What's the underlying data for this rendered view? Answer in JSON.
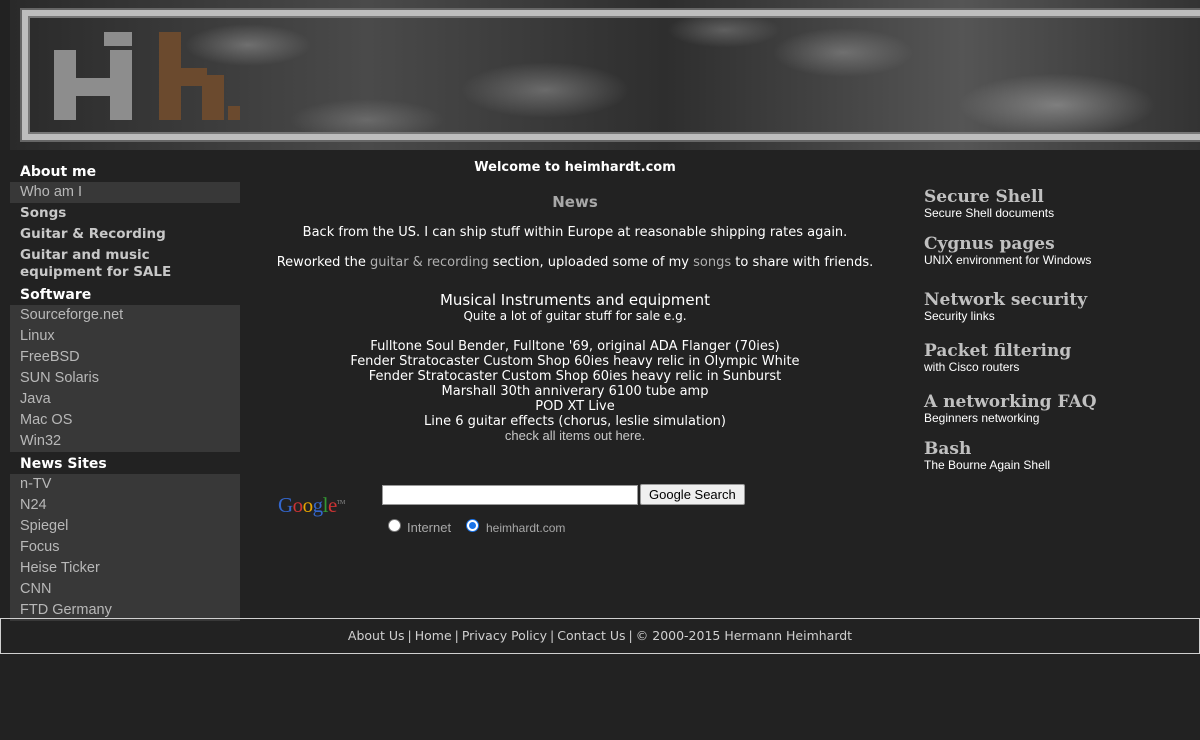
{
  "banner": {
    "logo_text": "hh."
  },
  "leftnav": {
    "about_head": "About me",
    "about_items": [
      "Who am I"
    ],
    "about_bold_items": [
      "Songs",
      "Guitar & Recording",
      "Guitar and music equipment for SALE"
    ],
    "software_head": "Software",
    "software_items": [
      "Sourceforge.net",
      "Linux",
      "FreeBSD",
      "SUN Solaris",
      "Java",
      "Mac OS",
      "Win32"
    ],
    "news_head": "News Sites",
    "news_items": [
      "n-TV",
      "N24",
      "Spiegel",
      "Focus",
      "Heise Ticker",
      "CNN",
      "FTD Germany"
    ]
  },
  "center": {
    "welcome": "Welcome to heimhardt.com",
    "news_title": "News",
    "news1": "Back from the US. I can ship stuff within Europe at reasonable shipping rates again.",
    "news2_pre": "Reworked the ",
    "news2_link1": "guitar & recording",
    "news2_mid": " section, uploaded some of my ",
    "news2_link2": "songs",
    "news2_post": " to share with friends.",
    "instr_title": "Musical Instruments and equipment",
    "instr_sub": "Quite a lot of guitar stuff for sale e.g.",
    "items": [
      "Fulltone Soul Bender, Fulltone '69, original ADA Flanger (70ies)",
      "Fender Stratocaster Custom Shop 60ies heavy relic in Olympic White",
      "Fender Stratocaster Custom Shop 60ies heavy relic in Sunburst",
      "Marshall 30th anniverary 6100 tube amp",
      "POD XT Live",
      "Line 6 guitar effects (chorus, leslie simulation)"
    ],
    "check_link": "check all items out here."
  },
  "search": {
    "logo_letters": [
      "G",
      "o",
      "o",
      "g",
      "l",
      "e"
    ],
    "logo_colors": [
      "#3366cc",
      "#cc3333",
      "#e6a300",
      "#3366cc",
      "#339933",
      "#cc3333"
    ],
    "logo_tm": "TM",
    "input_value": "",
    "button_label": "Google Search",
    "option_internet": "Internet",
    "option_site": "heimhardt.com",
    "selected": "heimhardt.com"
  },
  "rightcol": [
    {
      "title": "Secure Shell",
      "sub": "Secure Shell documents"
    },
    {
      "title": "Cygnus pages",
      "sub": "UNIX environment for Windows"
    },
    {
      "title": "Network security",
      "sub": "Security links"
    },
    {
      "title": "Packet filtering",
      "sub": "with Cisco routers"
    },
    {
      "title": "A networking FAQ",
      "sub": "Beginners networking"
    },
    {
      "title": "Bash",
      "sub": "The Bourne Again Shell"
    }
  ],
  "footer": {
    "about": "About Us",
    "home": "Home",
    "privacy": "Privacy Policy",
    "contact": "Contact Us",
    "copyright": "© 2000-2015 Hermann Heimhardt",
    "separator": "|"
  }
}
